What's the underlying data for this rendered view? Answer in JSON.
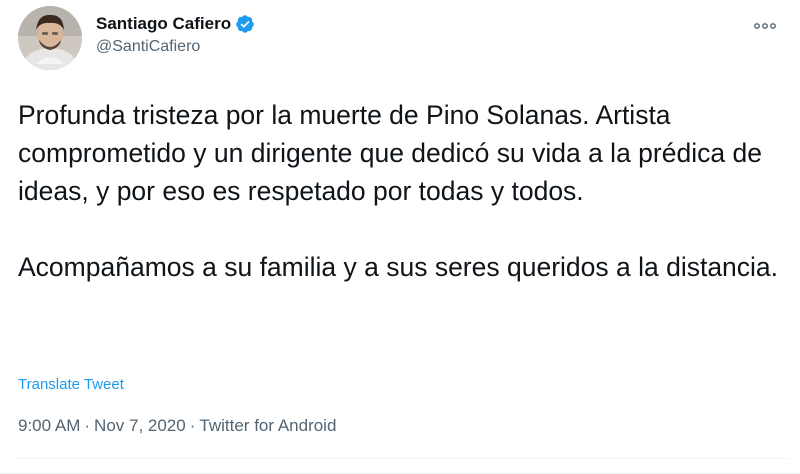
{
  "author": {
    "name": "Santiago Cafiero",
    "handle": "@SantiCafiero",
    "verified": true
  },
  "tweet": {
    "text": "Profunda tristeza por la muerte de Pino Solanas. Artista comprometido y un dirigente que dedicó su vida a la prédica de ideas, y por eso es respetado por todas y todos.\n\nAcompañamos a su familia y a sus seres queridos a la distancia.",
    "translate_label": "Translate Tweet",
    "time": "9:00 AM",
    "separator": "·",
    "date": "Nov 7, 2020",
    "source": "Twitter for Android"
  },
  "colors": {
    "accent": "#1d9bf0",
    "text": "#0f1419",
    "secondary": "#536471"
  },
  "icons": {
    "verified": "verified-badge-icon",
    "more": "more-options-icon"
  }
}
